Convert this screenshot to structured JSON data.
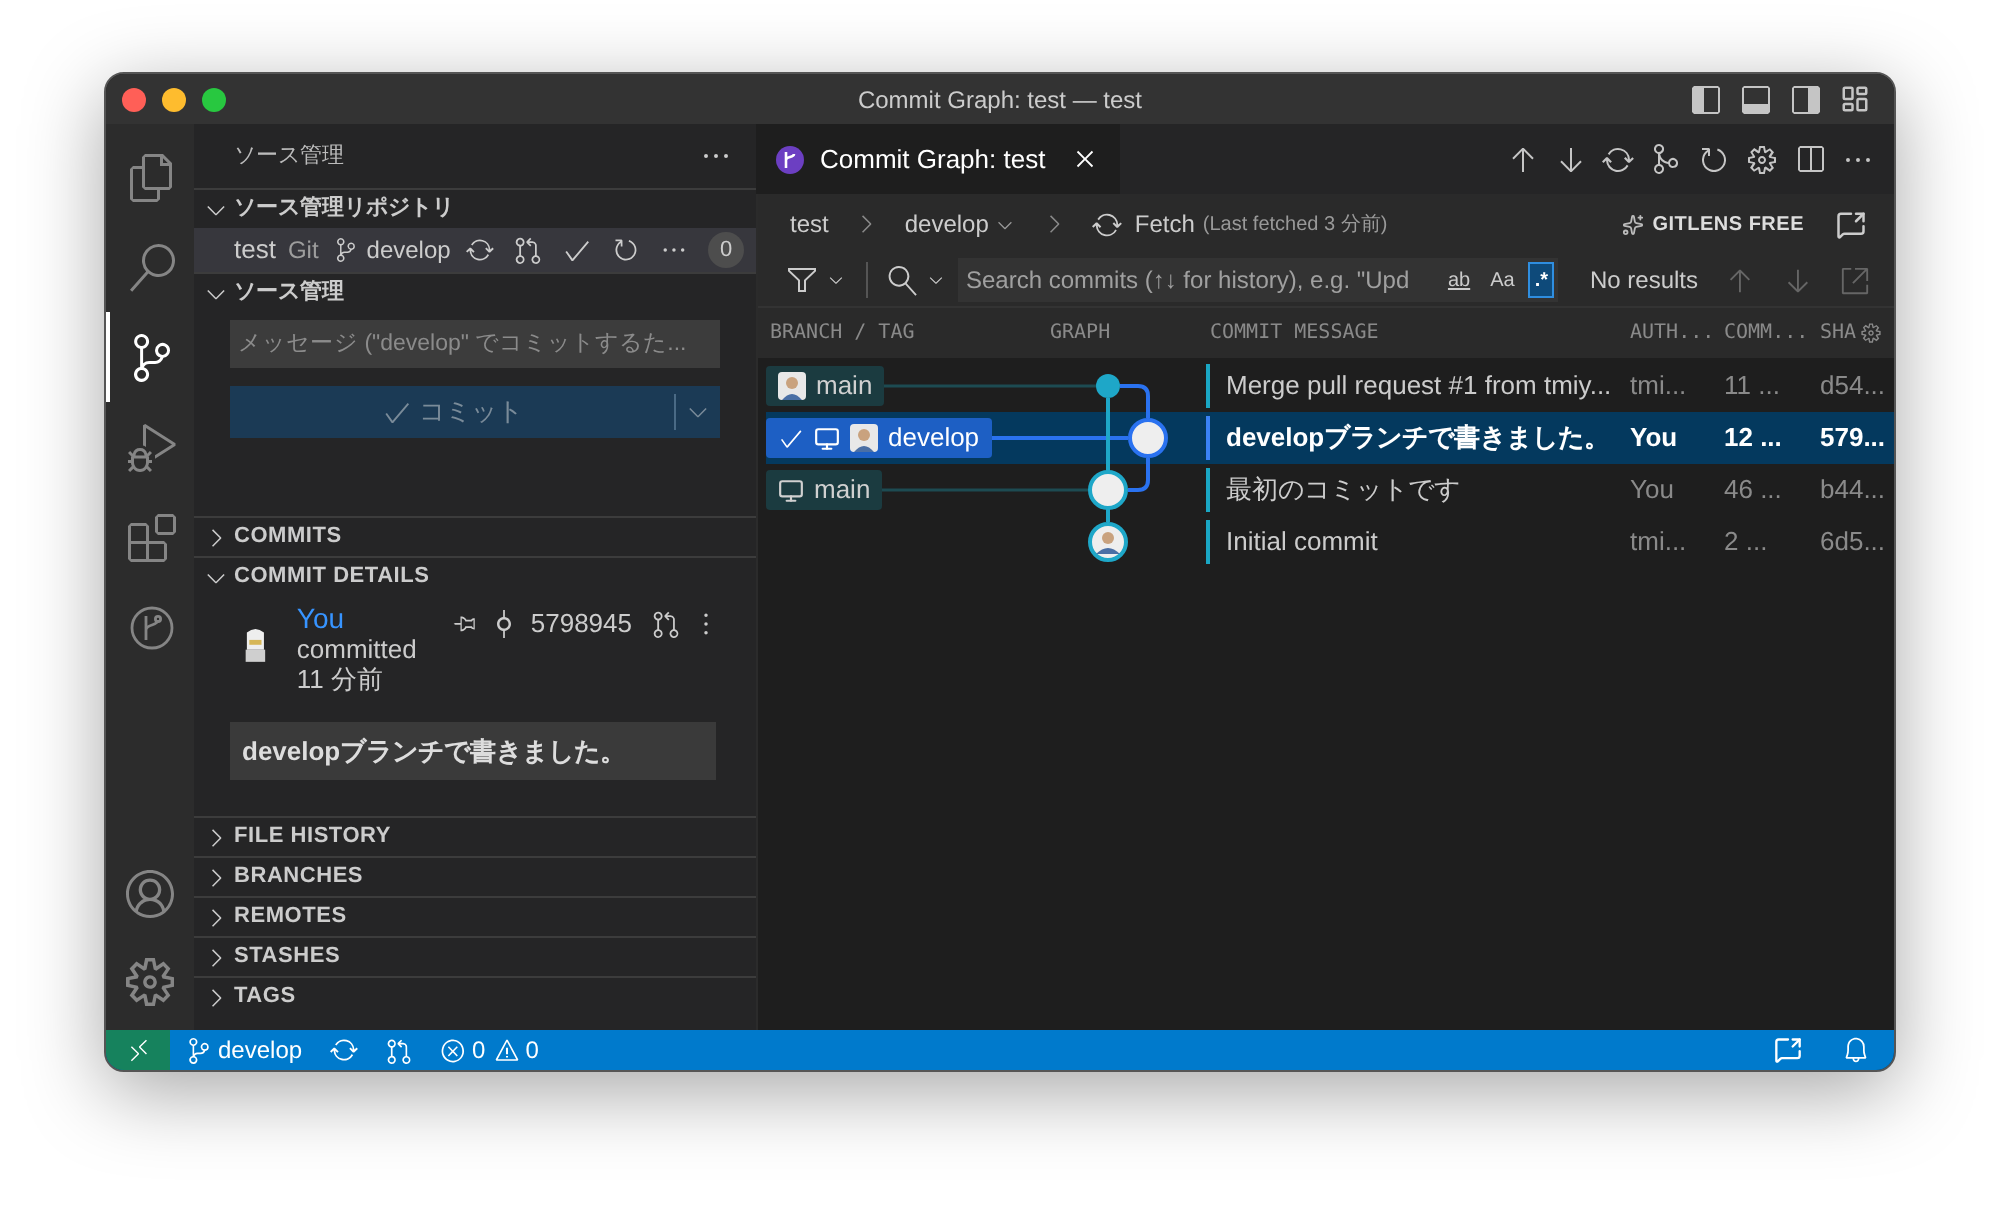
{
  "window": {
    "title": "Commit Graph: test — test"
  },
  "activity_bar": [
    {
      "kind": "files",
      "selected": false
    },
    {
      "kind": "search",
      "selected": false
    },
    {
      "kind": "scm",
      "selected": true
    },
    {
      "kind": "debug",
      "selected": false
    },
    {
      "kind": "extensions",
      "selected": false
    },
    {
      "kind": "gitlens",
      "selected": false
    }
  ],
  "sidebar": {
    "title": "ソース管理",
    "repositories": {
      "title": "ソース管理リポジトリ",
      "expanded": true,
      "repo": {
        "name": "test",
        "provider": "Git",
        "branch": "develop",
        "count": "0"
      }
    },
    "source_control": {
      "title": "ソース管理",
      "expanded": true,
      "message_placeholder": "メッセージ (\"develop\" でコミットするた...",
      "commit_label": "コミット"
    },
    "commits": {
      "title": "COMMITS",
      "expanded": false
    },
    "commit_details": {
      "title": "COMMIT DETAILS",
      "expanded": true,
      "author": "You",
      "action": "committed",
      "time": "11 分前",
      "sha": "5798945",
      "message": "developブランチで書きました。"
    },
    "sections": [
      {
        "title": "FILE HISTORY",
        "expanded": false
      },
      {
        "title": "BRANCHES",
        "expanded": false
      },
      {
        "title": "REMOTES",
        "expanded": false
      },
      {
        "title": "STASHES",
        "expanded": false
      },
      {
        "title": "TAGS",
        "expanded": false
      }
    ]
  },
  "editor": {
    "tabs": [
      {
        "label": "Commit Graph: test",
        "selected": true
      }
    ],
    "graph": {
      "breadcrumb": [
        "test",
        "develop"
      ],
      "fetch": {
        "label": "Fetch",
        "detail": "(Last fetched 3 分前)"
      },
      "plan": "GITLENS FREE",
      "search": {
        "placeholder": "Search commits (↑↓ for history), e.g. \"Upd",
        "toggles": [
          {
            "label": "ab",
            "selected": false
          },
          {
            "label": "Aa",
            "selected": false
          },
          {
            "label": ".*",
            "selected": true
          }
        ],
        "results": "No results"
      },
      "columns": [
        "BRANCH / TAG",
        "GRAPH",
        "COMMIT MESSAGE",
        "AUTH...",
        "COMM...",
        "SHA"
      ],
      "rows": [
        {
          "selected": false,
          "refs": [
            {
              "name": "main",
              "checked_out": false,
              "local": false,
              "remote": true
            }
          ],
          "message": "Merge pull request #1 from tmiy...",
          "author": "tmi...",
          "date": "11 ...",
          "sha": "d54..."
        },
        {
          "selected": true,
          "refs": [
            {
              "name": "develop",
              "checked_out": true,
              "local": true,
              "remote": true
            }
          ],
          "message": "developブランチで書きました。",
          "author": "You",
          "date": "12 ...",
          "sha": "579..."
        },
        {
          "selected": false,
          "refs": [
            {
              "name": "main",
              "checked_out": false,
              "local": true,
              "remote": false
            }
          ],
          "message": "最初のコミットです",
          "author": "You",
          "date": "46 ...",
          "sha": "b44..."
        },
        {
          "selected": false,
          "refs": [],
          "message": "Initial commit",
          "author": "tmi...",
          "date": "2 ...",
          "sha": "6d5..."
        }
      ]
    }
  },
  "status_bar": {
    "branch": "develop",
    "errors": "0",
    "warnings": "0"
  }
}
